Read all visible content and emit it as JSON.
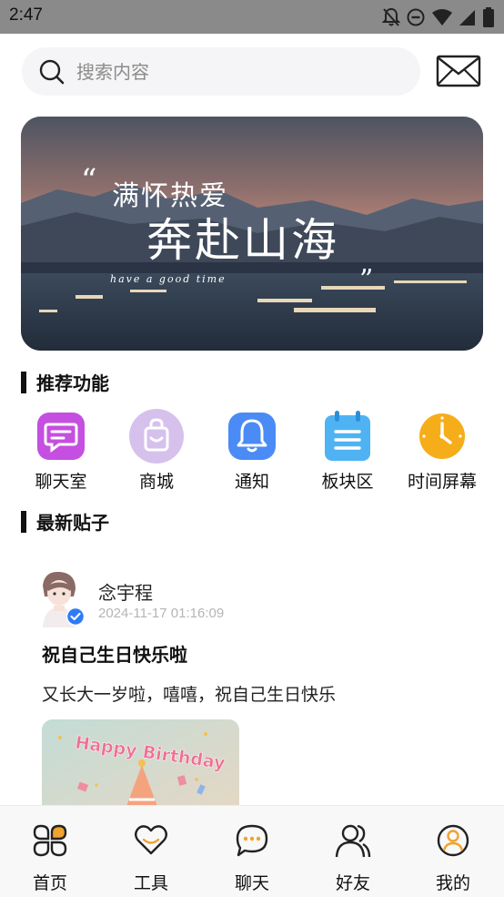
{
  "status_bar": {
    "time": "2:47",
    "icons": [
      "notifications-off-icon",
      "do-not-disturb-icon",
      "wifi-icon",
      "signal-icon",
      "battery-icon"
    ]
  },
  "search": {
    "placeholder": "搜索内容",
    "value": ""
  },
  "banner": {
    "line1": "满怀热爱",
    "line2": "奔赴山海",
    "subtitle": "have a good time"
  },
  "sections": {
    "recommended": "推荐功能",
    "latest_posts": "最新贴子"
  },
  "features": [
    {
      "label": "聊天室",
      "icon": "chat-room-icon",
      "color": "#c44fe0"
    },
    {
      "label": "商城",
      "icon": "shopping-bag-icon",
      "color": "#d6c1ec"
    },
    {
      "label": "通知",
      "icon": "bell-icon",
      "color": "#4a8bf5"
    },
    {
      "label": "板块区",
      "icon": "notepad-icon",
      "color": "#4fb3f3"
    },
    {
      "label": "时间屏幕",
      "icon": "clock-icon",
      "color": "#f6ad1a"
    }
  ],
  "post": {
    "author": "念宇程",
    "time": "2024-11-17 01:16:09",
    "title": "祝自己生日快乐啦",
    "content": "又长大一岁啦，嘻嘻，祝自己生日快乐",
    "image_text": "Happy Birthday"
  },
  "bottom_nav": [
    {
      "label": "首页",
      "icon": "home-icon"
    },
    {
      "label": "工具",
      "icon": "heart-icon"
    },
    {
      "label": "聊天",
      "icon": "chat-bubble-icon"
    },
    {
      "label": "好友",
      "icon": "friends-icon"
    },
    {
      "label": "我的",
      "icon": "profile-icon"
    }
  ],
  "colors": {
    "verified_badge": "#2f7bf6",
    "status_bar": "#8a8a8a",
    "profile_accent": "#f0a32e"
  }
}
